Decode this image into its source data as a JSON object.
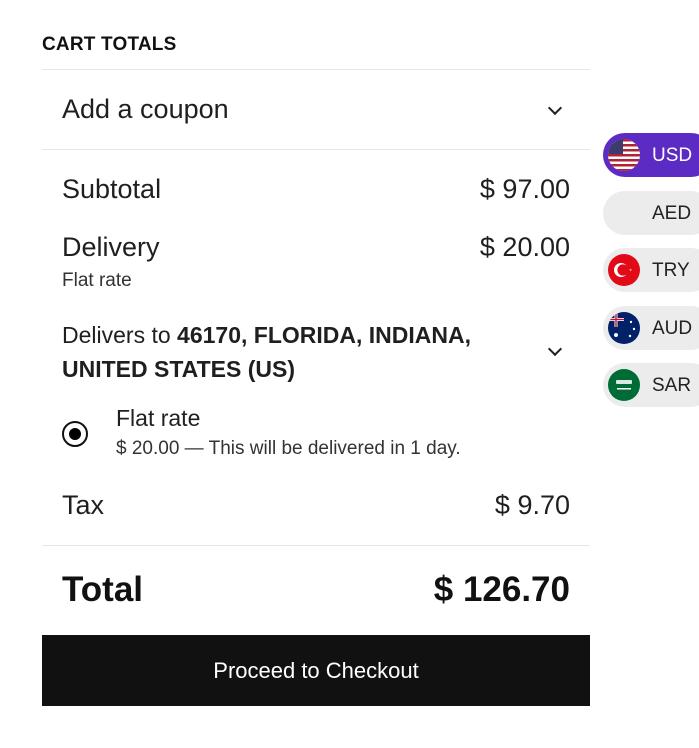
{
  "cart": {
    "heading": "CART TOTALS",
    "coupon_label": "Add a coupon",
    "subtotal_label": "Subtotal",
    "subtotal_value": "$ 97.00",
    "delivery_label": "Delivery",
    "delivery_value": "$ 20.00",
    "delivery_method": "Flat rate",
    "delivers_to_prefix": "Delivers to ",
    "delivers_to_address": "46170, FLORIDA, INDIANA, UNITED STATES (US)",
    "shipping_option_title": "Flat rate",
    "shipping_option_desc": "$ 20.00 — This will be delivered in 1 day.",
    "tax_label": "Tax",
    "tax_value": "$ 9.70",
    "total_label": "Total",
    "total_value": "$ 126.70",
    "checkout_label": "Proceed to Checkout"
  },
  "currencies": [
    {
      "code": "USD",
      "active": true,
      "flag": "us-flag-icon"
    },
    {
      "code": "AED",
      "active": false,
      "flag": "none"
    },
    {
      "code": "TRY",
      "active": false,
      "flag": "tr-flag-icon"
    },
    {
      "code": "AUD",
      "active": false,
      "flag": "au-flag-icon"
    },
    {
      "code": "SAR",
      "active": false,
      "flag": "sa-flag-icon"
    }
  ],
  "colors": {
    "active_currency": "#5b2bc4",
    "checkout_bg": "#111111"
  }
}
